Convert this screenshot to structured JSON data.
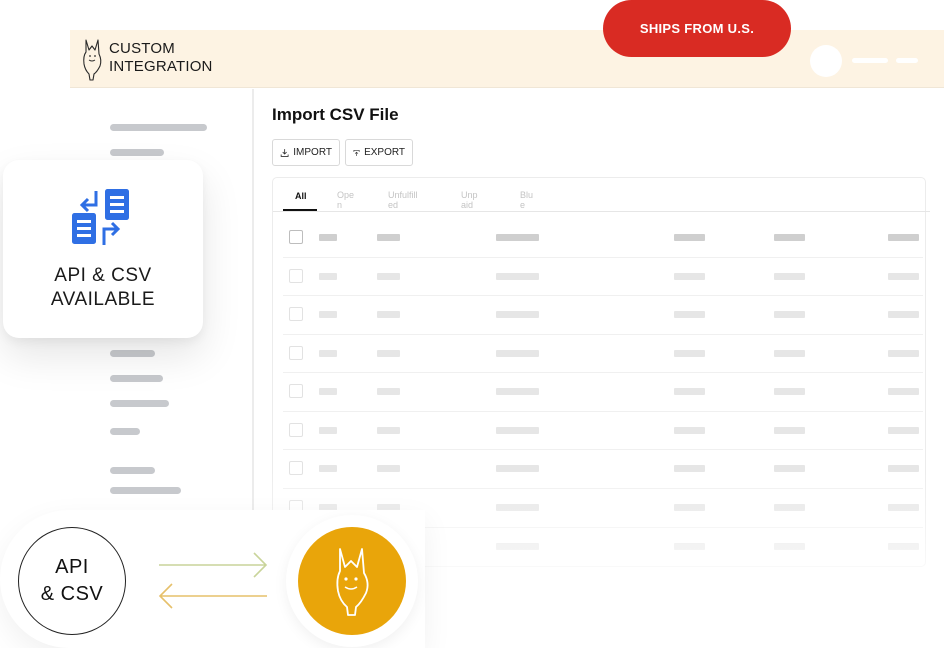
{
  "badge": {
    "label": "SHIPS FROM U.S."
  },
  "header": {
    "brand_line1": "CUSTOM",
    "brand_line2": "INTEGRATION",
    "logo_icon": "dog-head-logo-icon"
  },
  "card": {
    "icon": "api-csv-transfer-icon",
    "line1": "API & CSV",
    "line2": "AVAILABLE",
    "icon_color": "#2f6fe4"
  },
  "main": {
    "title": "Import CSV File",
    "import_label": "IMPORT",
    "export_label": "EXPORT",
    "tabs": [
      {
        "label": "All",
        "active": true
      },
      {
        "label": "Open",
        "active": false
      },
      {
        "label": "Unfulfilled",
        "active": false
      },
      {
        "label": "Unpaid",
        "active": false
      },
      {
        "label": "Blue",
        "active": false
      }
    ]
  },
  "bottom": {
    "api_line1": "API",
    "api_line2": "& CSV",
    "arrow_color": "#c9d49a",
    "brand_circle_color": "#e9a50a"
  },
  "colors": {
    "badge": "#d92b23",
    "header_bg": "#fdf3e3",
    "brand_gold": "#e9a50a",
    "accent_blue": "#2f6fe4"
  }
}
